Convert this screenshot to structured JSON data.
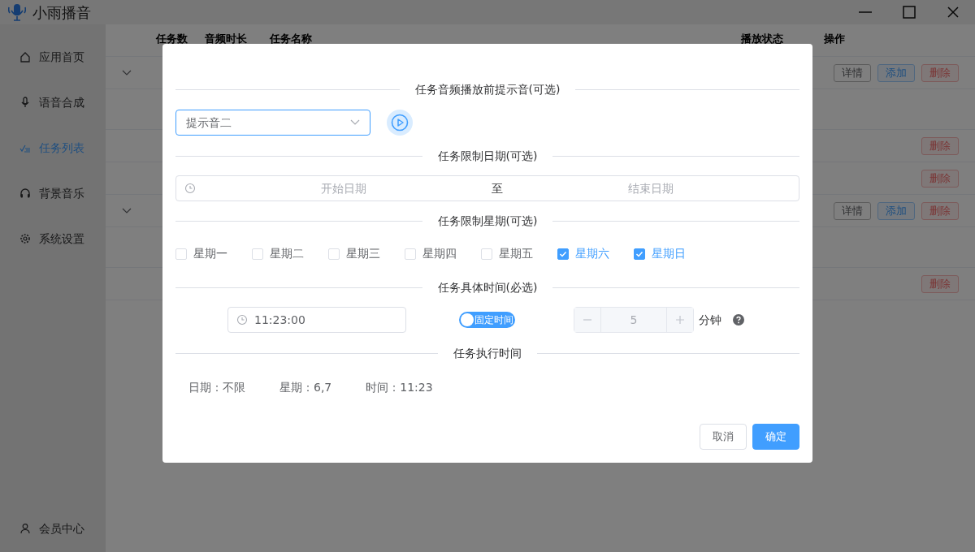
{
  "window": {
    "title": "小雨播音"
  },
  "sidebar": {
    "items": [
      {
        "label": "应用首页",
        "selected": false
      },
      {
        "label": "语音合成",
        "selected": false
      },
      {
        "label": "任务列表",
        "selected": true
      },
      {
        "label": "背景音乐",
        "selected": false
      },
      {
        "label": "系统设置",
        "selected": false
      }
    ],
    "footer": {
      "label": "会员中心"
    }
  },
  "table": {
    "columns": [
      {
        "label": "任务数",
        "kind": "left"
      },
      {
        "label": "音频时长",
        "kind": "left"
      },
      {
        "label": "任务名称",
        "kind": "left"
      },
      {
        "label": "播放状态",
        "kind": "right"
      },
      {
        "label": "操作",
        "kind": "right"
      }
    ],
    "rows": [
      {
        "kind": "group",
        "actions": [
          {
            "label": "详情",
            "kind": "default"
          },
          {
            "label": "添加",
            "kind": "primary"
          },
          {
            "label": "删除",
            "kind": "danger"
          }
        ]
      },
      {
        "kind": "blank"
      },
      {
        "kind": "item",
        "actions": [
          {
            "label": "删除",
            "kind": "danger"
          }
        ]
      },
      {
        "kind": "item",
        "actions": [
          {
            "label": "删除",
            "kind": "danger"
          }
        ]
      },
      {
        "kind": "group",
        "actions": [
          {
            "label": "详情",
            "kind": "default"
          },
          {
            "label": "添加",
            "kind": "primary"
          },
          {
            "label": "删除",
            "kind": "danger"
          }
        ]
      },
      {
        "kind": "blank"
      },
      {
        "kind": "item",
        "actions": [
          {
            "label": "删除",
            "kind": "danger"
          }
        ]
      }
    ]
  },
  "dialog": {
    "prompt_sound": {
      "heading": "任务音频播放前提示音(可选)",
      "value": "提示音二"
    },
    "date_range": {
      "heading": "任务限制日期(可选)",
      "start_placeholder": "开始日期",
      "separator": "至",
      "end_placeholder": "结束日期"
    },
    "weekdays": {
      "heading": "任务限制星期(可选)",
      "days": [
        {
          "label": "星期一",
          "checked": false
        },
        {
          "label": "星期二",
          "checked": false
        },
        {
          "label": "星期三",
          "checked": false
        },
        {
          "label": "星期四",
          "checked": false
        },
        {
          "label": "星期五",
          "checked": false
        },
        {
          "label": "星期六",
          "checked": true
        },
        {
          "label": "星期日",
          "checked": true
        }
      ]
    },
    "time": {
      "heading": "任务具体时间(必选)",
      "value": "11:23:00",
      "switch": {
        "label": "固定时间",
        "on": true
      },
      "stepper": {
        "value": "5",
        "disabled": true
      },
      "unit": "分钟"
    },
    "summary": {
      "heading": "任务执行时间",
      "items": [
        "日期：不限",
        "星期：6,7",
        "时间：11:23"
      ]
    },
    "buttons": [
      {
        "label": "取消",
        "kind": "default"
      },
      {
        "label": "确定",
        "kind": "primary"
      }
    ]
  }
}
